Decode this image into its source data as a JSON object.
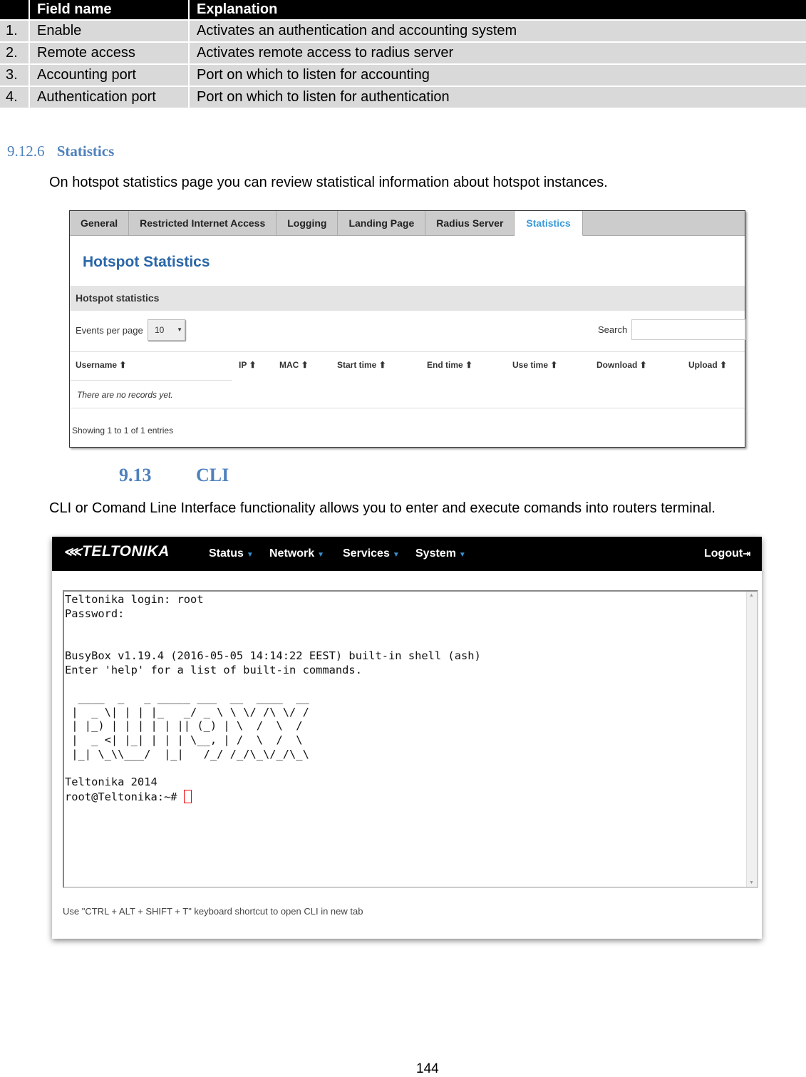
{
  "field_table": {
    "headers": [
      "",
      "Field name",
      "Explanation"
    ],
    "rows": [
      [
        "1.",
        "Enable",
        "Activates an authentication and accounting system"
      ],
      [
        "2.",
        "Remote access",
        "Activates remote access to radius server"
      ],
      [
        "3.",
        "Accounting port",
        "Port on which to listen for accounting"
      ],
      [
        "4.",
        "Authentication port",
        "Port on which to listen for authentication"
      ]
    ]
  },
  "section_stats": {
    "number": "9.12.6",
    "title": "Statistics",
    "text": "On hotspot statistics page you can review statistical information about hotspot instances."
  },
  "stats_screen": {
    "tabs": [
      "General",
      "Restricted Internet Access",
      "Logging",
      "Landing Page",
      "Radius Server",
      "Statistics"
    ],
    "active_tab": "Statistics",
    "title": "Hotspot Statistics",
    "section": "Hotspot statistics",
    "events_label": "Events per page",
    "events_value": "10",
    "search_label": "Search",
    "search_value": "",
    "columns": [
      "Username",
      "IP",
      "MAC",
      "Start time",
      "End time",
      "Use time",
      "Download",
      "Upload"
    ],
    "sort_icon": "sort-up-arrow-icon",
    "empty": "There are no records yet.",
    "showing": "Showing 1 to 1 of 1 entries",
    "accent": "#3a9ad9"
  },
  "section_cli": {
    "number": "9.13",
    "title": "CLI",
    "text": "CLI or Comand Line Interface functionality allows you to enter and execute comands into routers terminal."
  },
  "cli_screen": {
    "logo": "TELTONIKA",
    "menu": [
      "Status",
      "Network",
      "Services",
      "System"
    ],
    "logout": "Logout",
    "terminal_lines": [
      "Teltonika login: root",
      "Password:",
      "",
      "",
      "BusyBox v1.19.4 (2016-05-05 14:14:22 EEST) built-in shell (ash)",
      "Enter 'help' for a list of built-in commands.",
      "",
      "  ____  _   _ _____ ___  __  ____  __",
      " |  _ \\| | | |_   _/ _ \\ \\ \\/ /\\ \\/ /",
      " | |_) | | | | | || (_) | \\  /  \\  / ",
      " |  _ <| |_| | | | \\__, | /  \\  /  \\ ",
      " |_| \\_\\\\___/  |_|   /_/ /_/\\_\\/_/\\_\\",
      "",
      "Teltonika 2014"
    ],
    "prompt": "root@Teltonika:~# ",
    "hint": "Use \"CTRL + ALT + SHIFT + T\" keyboard shortcut to open CLI in new tab"
  },
  "page_number": "144"
}
